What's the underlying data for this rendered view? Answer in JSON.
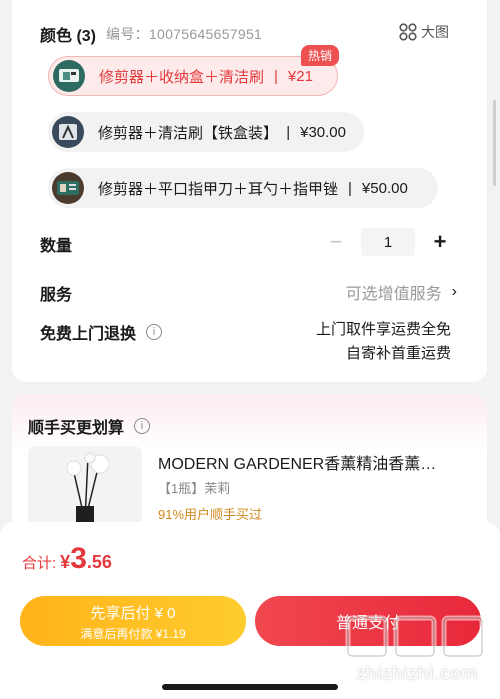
{
  "color_section": {
    "title": "颜色 (3)",
    "sku_label": "编号：",
    "sku_value": "10075645657951",
    "big_view_label": "大图"
  },
  "options": [
    {
      "name": "修剪器＋收纳盒＋清洁刷",
      "price": "¥21",
      "selected": true,
      "badge": "热销"
    },
    {
      "name": "修剪器＋清洁刷【铁盒装】",
      "price": "¥30.00",
      "selected": false
    },
    {
      "name": "修剪器＋平口指甲刀＋耳勺＋指甲锉",
      "price": "¥50.00",
      "selected": false
    }
  ],
  "quantity": {
    "label": "数量",
    "value": "1",
    "minus": "−",
    "plus": "+"
  },
  "service": {
    "label": "服务",
    "value": "可选增值服务",
    "chevron": "›"
  },
  "returns": {
    "label": "免费上门退换",
    "info_icon": "i",
    "line1": "上门取件享运费全免",
    "line2": "自寄补首重运费"
  },
  "bundle": {
    "title": "顺手买更划算",
    "info_icon": "i",
    "product_title": "MODERN GARDENER香薰精油香薰…",
    "product_spec": "【1瓶】茉莉",
    "product_pct": "91%用户顺手买过"
  },
  "checkout": {
    "total_label": "合计:",
    "currency": "¥",
    "amount_int": "3",
    "amount_dec": ".56",
    "pay_later_line1": "先享后付 ¥ 0",
    "pay_later_line2": "满意后再付款 ¥1.19",
    "normal_pay": "普通支付"
  },
  "watermark": {
    "text": "zhizhizhi.com"
  },
  "colors": {
    "accent": "#e4393c",
    "pay_later": "#ffbe22",
    "pct": "#d18a1f"
  }
}
